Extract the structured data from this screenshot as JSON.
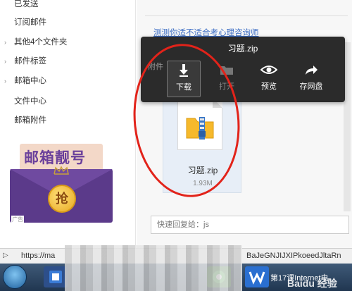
{
  "sidebar": {
    "items": [
      {
        "label": "已发送",
        "has_arrow": false
      },
      {
        "label": "订阅邮件",
        "has_arrow": false
      },
      {
        "label": "其他4个文件夹",
        "has_arrow": true
      },
      {
        "label": "邮件标签",
        "has_arrow": true
      },
      {
        "label": "邮箱中心",
        "has_arrow": true
      },
      {
        "label": "文件中心",
        "has_arrow": false
      },
      {
        "label": "邮箱附件",
        "has_arrow": false
      }
    ],
    "arrow_glyph": "›"
  },
  "ad": {
    "title": "邮箱靓号",
    "coin_text": "抢",
    "tag": "广告"
  },
  "main": {
    "link_text": "测测你适不适合考心理咨询师",
    "attach_header": "附件"
  },
  "popup": {
    "title": "习题.zip",
    "actions": [
      {
        "label": "下载",
        "icon": "download-icon",
        "state": "active"
      },
      {
        "label": "打开",
        "icon": "open-folder-icon",
        "state": "dim"
      },
      {
        "label": "预览",
        "icon": "preview-eye-icon",
        "state": "normal"
      },
      {
        "label": "存网盘",
        "icon": "share-arrow-icon",
        "state": "normal"
      }
    ]
  },
  "file": {
    "name": "习题.zip",
    "size": "1.93M"
  },
  "reply": {
    "placeholder": "快速回复给：js"
  },
  "statusbar": {
    "url_start": "https://ma",
    "url_end": "BaJeGNJIJXIPkoeedJltaRn"
  },
  "taskbar": {
    "task_label": "第17课Internet电...",
    "watermark": "Baidu 经验"
  },
  "colors": {
    "annotation": "#e2231a",
    "link": "#3a6cc4",
    "popup_bg": "#2b2b2b",
    "ad_purple": "#5b3a8a"
  }
}
